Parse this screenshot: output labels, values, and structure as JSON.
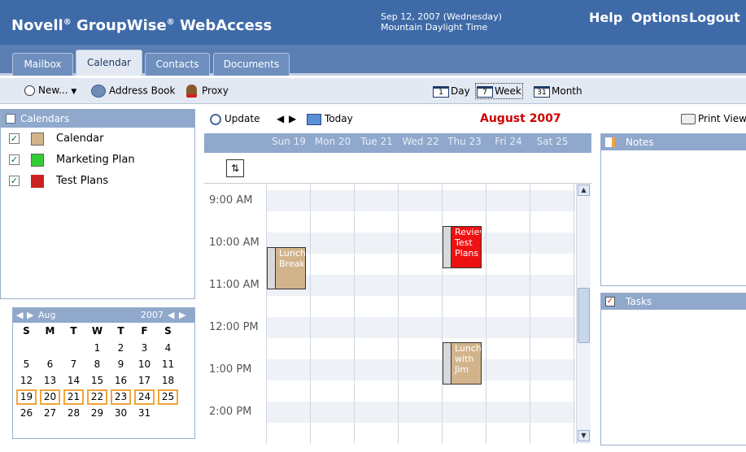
{
  "header": {
    "brand_pre": "Novell",
    "brand_mid": "GroupWise",
    "brand_post": "WebAccess",
    "reg": "®",
    "date": "Sep 12, 2007 (Wednesday)",
    "timezone": "Mountain Daylight Time",
    "links": [
      "Help",
      "Options",
      "Logout"
    ]
  },
  "tabs": [
    "Mailbox",
    "Calendar",
    "Contacts",
    "Documents"
  ],
  "active_tab": "Calendar",
  "toolbar": {
    "new_label": "New...",
    "address_book_label": "Address Book",
    "proxy_label": "Proxy"
  },
  "views": [
    {
      "num": "1",
      "label": "Day"
    },
    {
      "num": "7",
      "label": "Week"
    },
    {
      "num": "31",
      "label": "Month"
    }
  ],
  "active_view": "Week",
  "calendars": {
    "title": "Calendars",
    "items": [
      {
        "name": "Calendar",
        "color": "#d2b48c",
        "checked": true
      },
      {
        "name": "Marketing Plan",
        "color": "#33cc33",
        "checked": true
      },
      {
        "name": "Test Plans",
        "color": "#cc2222",
        "checked": true
      }
    ]
  },
  "mini_calendar": {
    "month": "Aug",
    "year": "2007",
    "day_names": [
      "S",
      "M",
      "T",
      "W",
      "T",
      "F",
      "S"
    ],
    "weeks": [
      [
        "",
        "",
        "",
        "1",
        "2",
        "3",
        "4"
      ],
      [
        "5",
        "6",
        "7",
        "8",
        "9",
        "10",
        "11"
      ],
      [
        "12",
        "13",
        "14",
        "15",
        "16",
        "17",
        "18"
      ],
      [
        "19",
        "20",
        "21",
        "22",
        "23",
        "24",
        "25"
      ],
      [
        "26",
        "27",
        "28",
        "29",
        "30",
        "31",
        ""
      ]
    ],
    "selected_week": 3
  },
  "calendar_bar": {
    "update_label": "Update",
    "today_label": "Today",
    "month_title": "August 2007",
    "print_label": "Print View"
  },
  "days": [
    "Sun 19",
    "Mon 20",
    "Tue 21",
    "Wed 22",
    "Thu 23",
    "Fri 24",
    "Sat 25"
  ],
  "times": [
    "9:00 AM",
    "10:00 AM",
    "11:00 AM",
    "12:00 PM",
    "1:00 PM",
    "2:00 PM"
  ],
  "appointments": [
    {
      "day": "Sun 19",
      "start": "10:15 AM",
      "end": "11:15 AM",
      "text": "Lunch Break",
      "color": "#d2b48c"
    },
    {
      "day": "Thu 23",
      "start": "9:45 AM",
      "end": "10:45 AM",
      "text": "Review Test Plans",
      "color": "#ee1111"
    },
    {
      "day": "Thu 23",
      "start": "12:30 PM",
      "end": "1:30 PM",
      "text": "Lunch with Jim",
      "color": "#d2b48c"
    }
  ],
  "notes_title": "Notes",
  "tasks_title": "Tasks",
  "colors": {
    "header": "#3e6aa8",
    "tabbar": "#5b7fb3",
    "pane_header": "#8fa8cc",
    "month_title": "#cc0000",
    "selected_week_border": "#f2a33a"
  }
}
